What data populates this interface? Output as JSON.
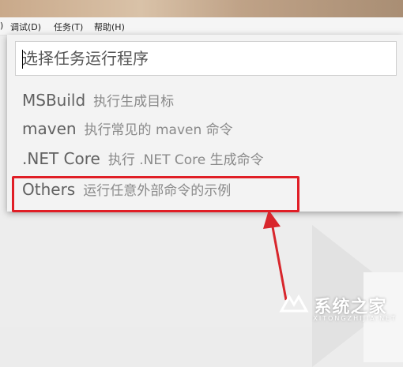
{
  "menubar": {
    "items": [
      ")",
      "调试(D)",
      "任务(T)",
      "帮助(H)"
    ]
  },
  "quickpick": {
    "placeholder": "选择任务运行程序",
    "items": [
      {
        "label": "MSBuild",
        "description": "执行生成目标"
      },
      {
        "label": "maven",
        "description": "执行常见的 maven 命令"
      },
      {
        "label": ".NET Core",
        "description": "执行 .NET Core 生成命令"
      },
      {
        "label": "Others",
        "description": "运行任意外部命令的示例"
      }
    ]
  },
  "annotation": {
    "highlight_color": "#e01e26",
    "highlighted_item": "Others"
  },
  "watermark": {
    "name": "系统之家",
    "domain": "XITONGZHIJIA.NET"
  }
}
